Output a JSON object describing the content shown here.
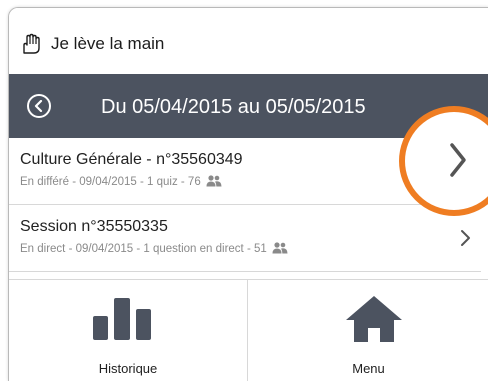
{
  "header": {
    "title": "Je lève la main",
    "logo_icon": "raised-hand-icon"
  },
  "date_bar": {
    "range": "Du 05/04/2015 au 05/05/2015",
    "back_icon": "back-circle-icon",
    "background": "#4c5360"
  },
  "sessions": [
    {
      "title": "Culture Générale - n°35560349",
      "meta": "En différé - 09/04/2015 - 1 quiz - 76",
      "meta_icon": "people-icon"
    },
    {
      "title": "Session n°35550335",
      "meta": "En direct - 09/04/2015 - 1 question en direct - 51",
      "meta_icon": "people-icon"
    }
  ],
  "highlight": {
    "color": "#ef7d22",
    "icon": "chevron-right-icon"
  },
  "nav": {
    "history_label": "Historique",
    "history_icon": "bar-chart-icon",
    "menu_label": "Menu",
    "menu_icon": "home-icon"
  }
}
